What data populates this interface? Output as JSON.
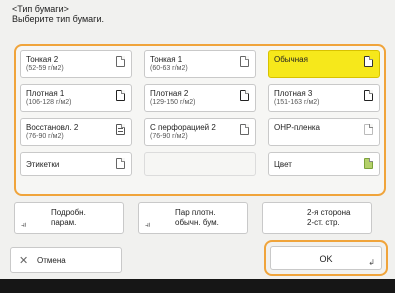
{
  "header": {
    "title": "<Тип бумаги>",
    "instruction": "Выберите тип бумаги."
  },
  "paper_types": [
    {
      "name": "Тонкая 2",
      "weight": "(52-59 г/м2)",
      "icon": "paper-icon",
      "selected": false
    },
    {
      "name": "Тонкая 1",
      "weight": "(60-63 г/м2)",
      "icon": "paper-icon",
      "selected": false
    },
    {
      "name": "Обычная",
      "weight": "",
      "icon": "paper-icon",
      "selected": true
    },
    {
      "name": "Плотная 1",
      "weight": "(106-128 г/м2)",
      "icon": "thick-paper-icon",
      "selected": false
    },
    {
      "name": "Плотная 2",
      "weight": "(129-150 г/м2)",
      "icon": "thick-paper-icon",
      "selected": false
    },
    {
      "name": "Плотная 3",
      "weight": "(151-163 г/м2)",
      "icon": "thick-paper-icon",
      "selected": false
    },
    {
      "name": "Восстановл. 2",
      "weight": "(76-90 г/м2)",
      "icon": "recycled-paper-icon",
      "selected": false
    },
    {
      "name": "С перфорацией 2",
      "weight": "(76-90 г/м2)",
      "icon": "paper-icon",
      "selected": false
    },
    {
      "name": "OHP-пленка",
      "weight": "",
      "icon": "transparency-icon",
      "selected": false
    },
    {
      "name": "Этикетки",
      "weight": "",
      "icon": "paper-icon",
      "selected": false
    },
    {
      "name": "Цвет",
      "weight": "",
      "icon": "color-paper-icon",
      "selected": false
    }
  ],
  "options": {
    "details_line1": "Подробн.",
    "details_line2": "парам.",
    "thick_line1": "Пар плотн.",
    "thick_line2": "обычн. бум.",
    "duplex_line1": "2-я сторона",
    "duplex_line2": "2-ст. стр."
  },
  "footer_buttons": {
    "cancel": "Отмена",
    "ok": "OK"
  },
  "colors": {
    "accent": "#f0a43b",
    "selected": "#f6e81b"
  }
}
